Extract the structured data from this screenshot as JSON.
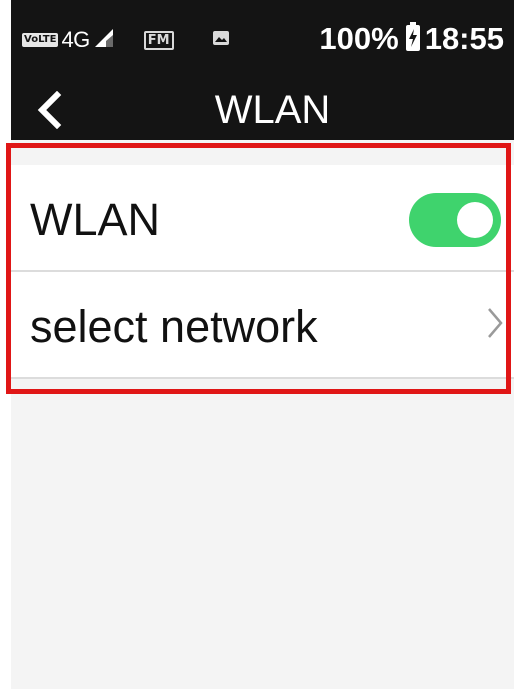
{
  "status_bar": {
    "volte": "VoLTE",
    "network_type": "4G",
    "fm": "FM",
    "battery_percent": "100%",
    "time": "18:55"
  },
  "header": {
    "title": "WLAN"
  },
  "settings": {
    "rows": [
      {
        "label": "WLAN",
        "control": "toggle",
        "toggle_on": true
      },
      {
        "label": "select network",
        "control": "chevron"
      }
    ]
  },
  "colors": {
    "bar_background": "#141414",
    "toggle_on": "#3fd36d",
    "highlight_border": "#e01616",
    "screen_background": "#f4f4f4"
  },
  "icons": {
    "signal": "signal-strength-icon",
    "image": "image-notification-icon",
    "battery": "battery-charging-icon",
    "back": "back-arrow-icon",
    "chevron": "chevron-right-icon"
  }
}
